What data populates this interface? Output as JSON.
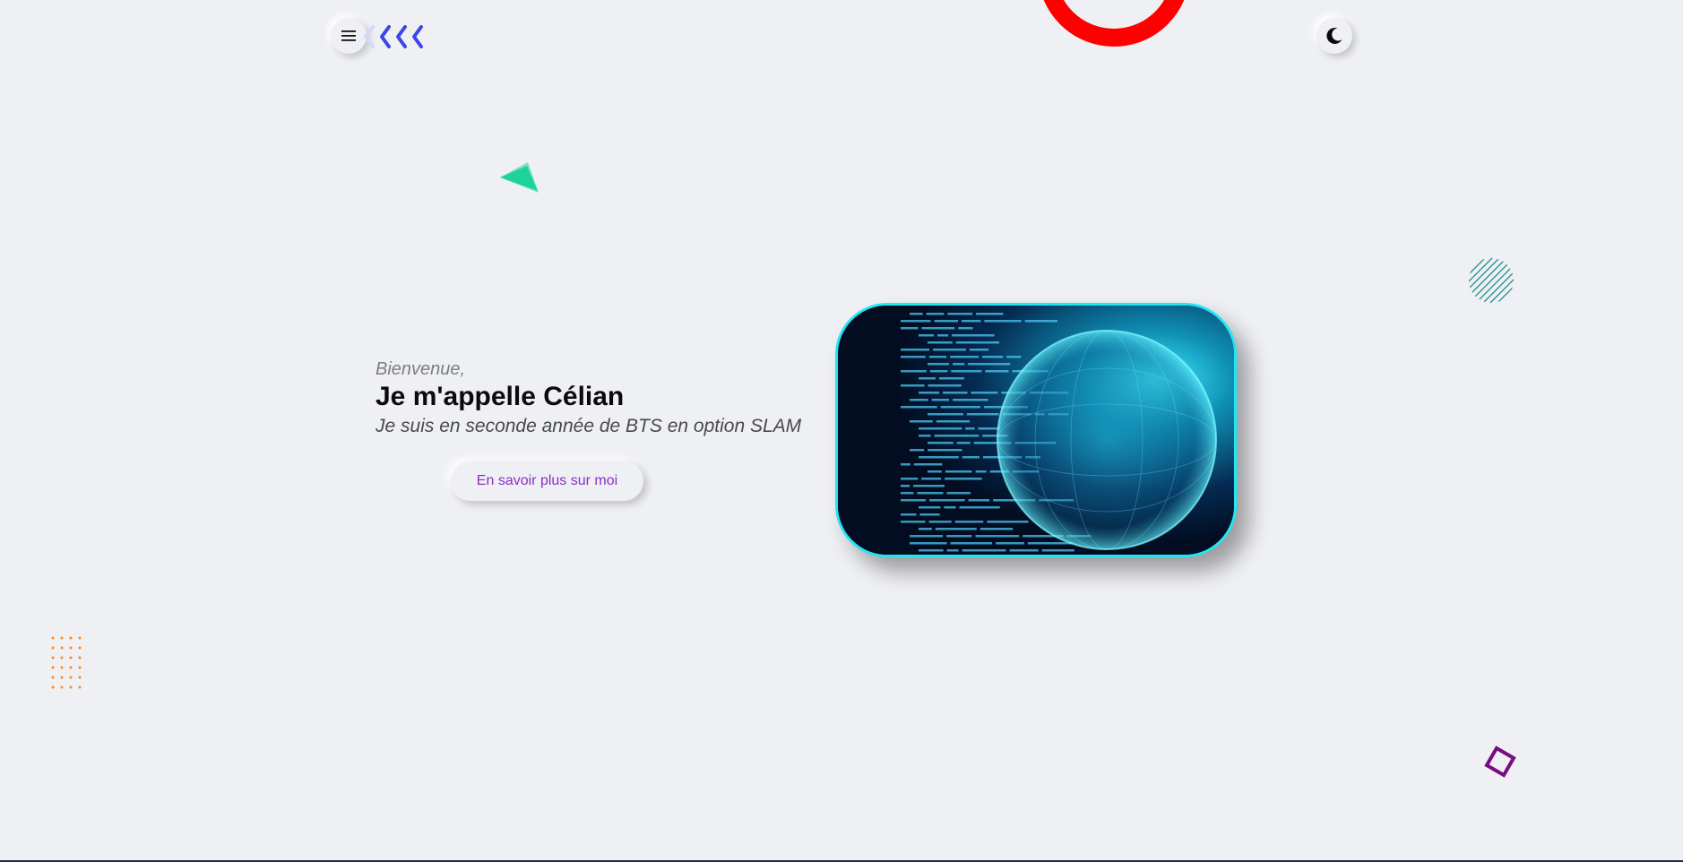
{
  "header": {
    "menu_icon": "hamburger-icon",
    "back_icon": "chevrons-left-icon",
    "theme_icon": "moon-icon"
  },
  "hero": {
    "greeting": "Bienvenue,",
    "name": "Je m'appelle Célian",
    "subtitle": "Je suis en seconde année de BTS en option SLAM",
    "cta_label": "En savoir plus sur moi",
    "image_icon": "code-globe-image"
  },
  "decorations": {
    "ring_color": "#ff0000",
    "triangle_color": "#1ed39a",
    "stripe_circle_color": "#1a8a86",
    "dots_color": "#ff8a1a",
    "diamond_color": "#7a0c82",
    "chevron_color": "#3b46e8"
  },
  "colors": {
    "background": "#eff0f4",
    "accent": "#8a2fc2",
    "image_border": "#22e6f2"
  }
}
